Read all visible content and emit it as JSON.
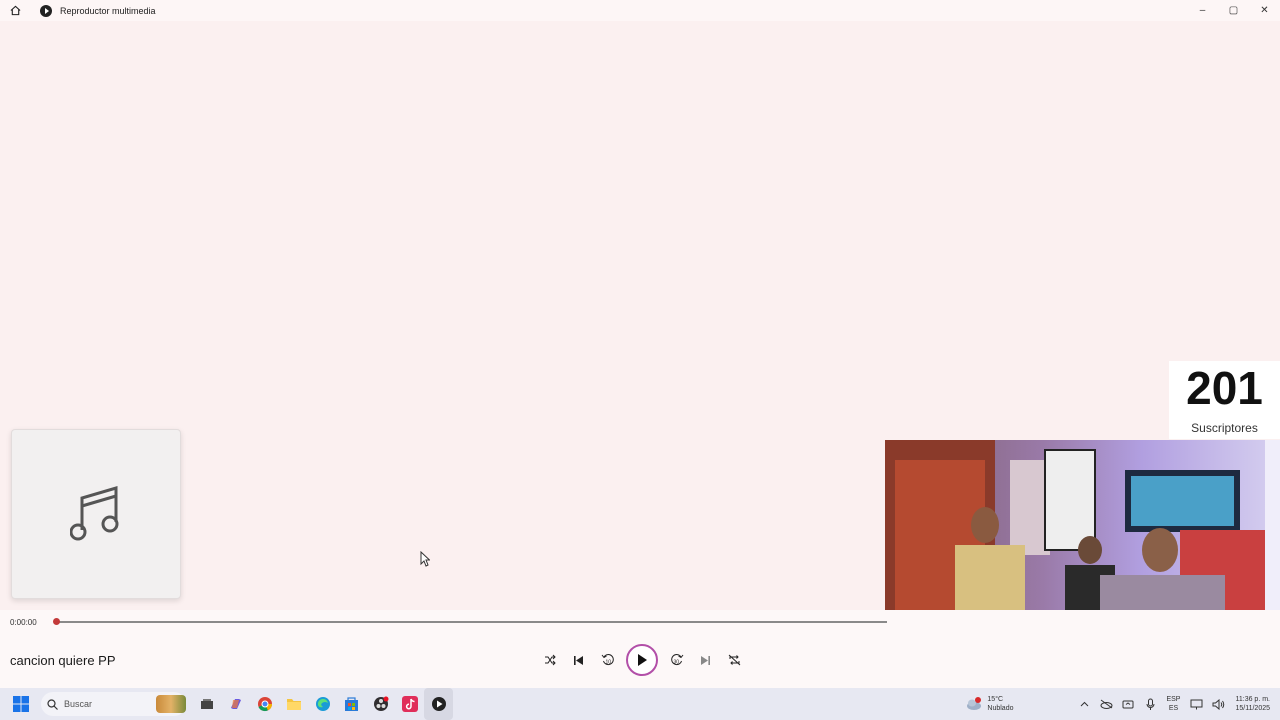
{
  "titlebar": {
    "title": "Reproductor multimedia",
    "home_icon": "home-icon",
    "app_icon": "media-player-icon",
    "minimize": "–",
    "maximize": "▢",
    "close": "✕"
  },
  "album": {
    "icon": "music-note-icon"
  },
  "overlay": {
    "subscriber_count": "201",
    "subscriber_label": "Suscriptores"
  },
  "player": {
    "time_elapsed": "0:00:00",
    "progress": 0,
    "song_title": "cancion quiere PP",
    "controls": [
      "shuffle",
      "previous",
      "rewind-10",
      "play",
      "forward-30",
      "next",
      "repeat"
    ],
    "rewind_label": "10",
    "forward_label": "30"
  },
  "taskbar": {
    "search_placeholder": "Buscar",
    "apps": [
      "start",
      "search",
      "task-view",
      "copilot",
      "chrome",
      "file-explorer",
      "edge",
      "store",
      "obs",
      "tiktok",
      "media-player"
    ],
    "weather": {
      "temp": "15°C",
      "condition": "Nublado",
      "badge": "1"
    },
    "lang_top": "ESP",
    "lang_bottom": "ES",
    "time": "11:36 p. m.",
    "date": "15/11/2025"
  },
  "colors": {
    "accent": "#c33a3a",
    "play_ring": "#b24fa8",
    "background": "#fbf0f0",
    "taskbar": "#e7e8f2"
  }
}
